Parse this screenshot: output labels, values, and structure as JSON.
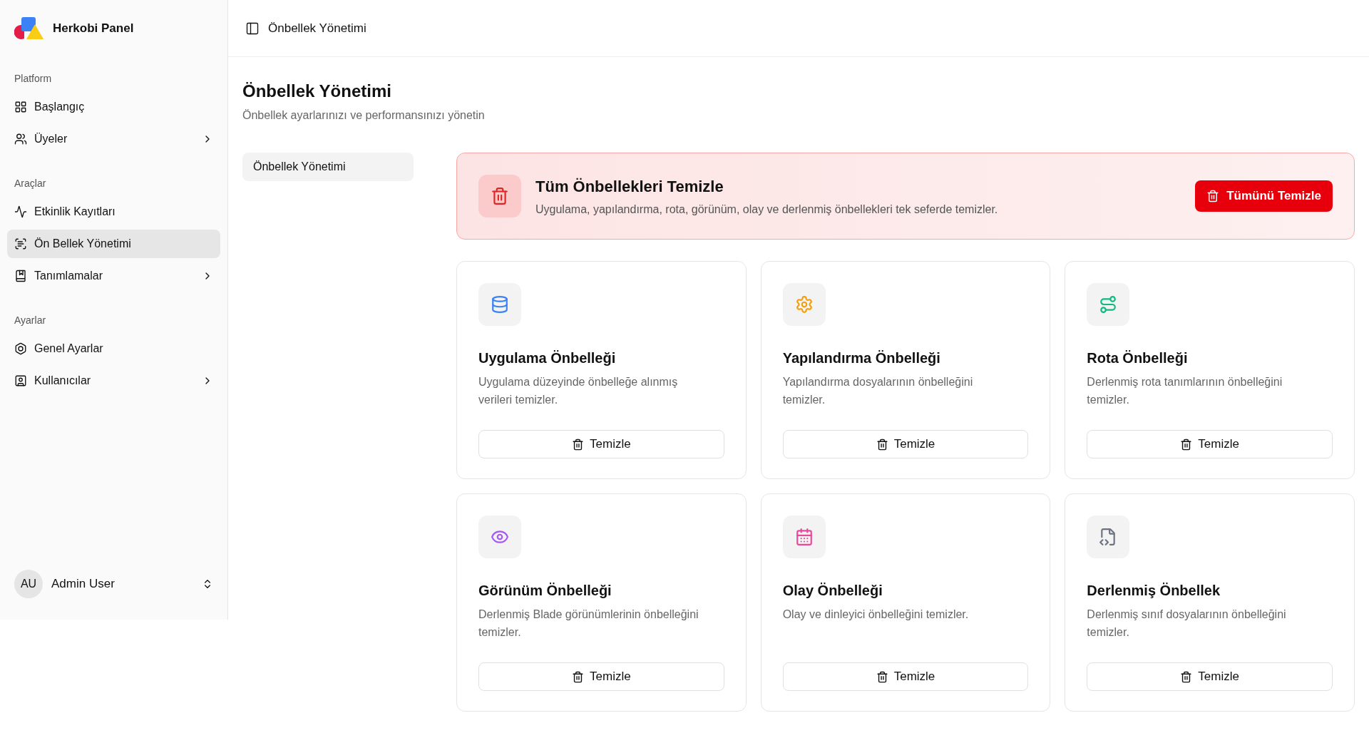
{
  "sidebar": {
    "brand": "Herkobi Panel",
    "groups": [
      {
        "label": "Platform",
        "items": [
          {
            "label": "Başlangıç",
            "selected": false,
            "expandable": false
          },
          {
            "label": "Üyeler",
            "selected": false,
            "expandable": true
          }
        ]
      },
      {
        "label": "Araçlar",
        "items": [
          {
            "label": "Etkinlik Kayıtları",
            "selected": false,
            "expandable": false
          },
          {
            "label": "Ön Bellek Yönetimi",
            "selected": true,
            "expandable": false
          },
          {
            "label": "Tanımlamalar",
            "selected": false,
            "expandable": true
          }
        ]
      },
      {
        "label": "Ayarlar",
        "items": [
          {
            "label": "Genel Ayarlar",
            "selected": false,
            "expandable": false
          },
          {
            "label": "Kullanıcılar",
            "selected": false,
            "expandable": true
          }
        ]
      }
    ],
    "user": {
      "initials": "AU",
      "name": "Admin User"
    }
  },
  "header": {
    "breadcrumb": "Önbellek Yönetimi"
  },
  "page": {
    "title": "Önbellek Yönetimi",
    "subtitle": "Önbellek ayarlarınızı ve performansınızı yönetin"
  },
  "subnav": [
    {
      "label": "Önbellek Yönetimi",
      "selected": true
    }
  ],
  "banner": {
    "title": "Tüm Önbellekleri Temizle",
    "description": "Uygulama, yapılandırma, rota, görünüm, olay ve derlenmiş önbellekleri tek seferde temizler.",
    "button": "Tümünü Temizle"
  },
  "cards": [
    {
      "title": "Uygulama Önbelleği",
      "description": "Uygulama düzeyinde önbelleğe alınmış verileri temizler.",
      "button": "Temizle",
      "color": "#3b82f6"
    },
    {
      "title": "Yapılandırma Önbelleği",
      "description": "Yapılandırma dosyalarının önbelleğini temizler.",
      "button": "Temizle",
      "color": "#f59e0b"
    },
    {
      "title": "Rota Önbelleği",
      "description": "Derlenmiş rota tanımlarının önbelleğini temizler.",
      "button": "Temizle",
      "color": "#10b981"
    },
    {
      "title": "Görünüm Önbelleği",
      "description": "Derlenmiş Blade görünümlerinin önbelleğini temizler.",
      "button": "Temizle",
      "color": "#a855f7"
    },
    {
      "title": "Olay Önbelleği",
      "description": "Olay ve dinleyici önbelleğini temizler.",
      "button": "Temizle",
      "color": "#ec4899"
    },
    {
      "title": "Derlenmiş Önbellek",
      "description": "Derlenmiş sınıf dosyalarının önbelleğini temizler.",
      "button": "Temizle",
      "color": "#6b7280"
    }
  ]
}
